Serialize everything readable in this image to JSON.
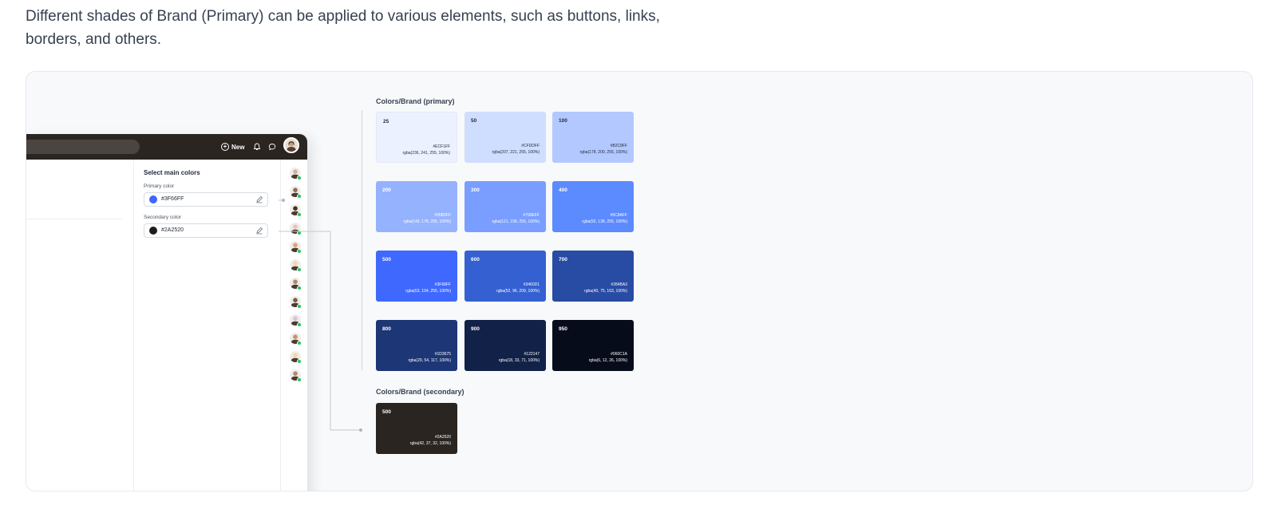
{
  "intro": {
    "text": "Different shades of Brand (Primary) can be applied to various elements, such as buttons, links, borders, and others."
  },
  "app": {
    "topbar": {
      "new_label": "New",
      "icons": [
        "plus-circle-icon",
        "bell-icon",
        "chat-icon"
      ]
    },
    "settings": {
      "title": "Select main colors",
      "primary_label": "Primary color",
      "primary_value": "#3F66FF",
      "primary_swatch": "#3F66FF",
      "secondary_label": "Secondary color",
      "secondary_value": "#2A2520",
      "secondary_swatch": "#1f1b17"
    },
    "avatars": [
      "#c9b49f",
      "#8a6f5c",
      "#3d3128",
      "#e3c2c8",
      "#d9a27a",
      "#f0d3b8",
      "#b0876a",
      "#7c5a48",
      "#d6c1e0",
      "#c49070",
      "#f1d7b0",
      "#a88c74"
    ]
  },
  "palette": {
    "primary": {
      "title": "Colors/Brand (primary)",
      "shades": [
        {
          "shade": "25",
          "hex": "#ECF1FF",
          "rgba": "rgba(236, 241, 255, 100%)",
          "bg": "#ECF1FF",
          "text": "#1f2937"
        },
        {
          "shade": "50",
          "hex": "#CFDDFF",
          "rgba": "rgba(207, 221, 255, 100%)",
          "bg": "#CFDDFF",
          "text": "#1f2937"
        },
        {
          "shade": "100",
          "hex": "#B2C8FF",
          "rgba": "rgba(178, 200, 255, 100%)",
          "bg": "#B2C8FF",
          "text": "#1f2937"
        },
        {
          "shade": "200",
          "hex": "#95B2FF",
          "rgba": "rgba(149, 178, 255, 100%)",
          "bg": "#95B2FF",
          "text": "#ffffff"
        },
        {
          "shade": "300",
          "hex": "#799EFF",
          "rgba": "rgba(121, 158, 255, 100%)",
          "bg": "#799EFF",
          "text": "#ffffff"
        },
        {
          "shade": "400",
          "hex": "#5C8AFF",
          "rgba": "rgba(92, 138, 255, 100%)",
          "bg": "#5C8AFF",
          "text": "#ffffff"
        },
        {
          "shade": "500",
          "hex": "#3F68FF",
          "rgba": "rgba(63, 104, 255, 100%)",
          "bg": "#3F68FF",
          "text": "#ffffff"
        },
        {
          "shade": "600",
          "hex": "#3460D1",
          "rgba": "rgba(52, 96, 209, 100%)",
          "bg": "#3460D1",
          "text": "#ffffff"
        },
        {
          "shade": "700",
          "hex": "#284BA3",
          "rgba": "rgba(40, 75, 163, 100%)",
          "bg": "#284BA3",
          "text": "#ffffff"
        },
        {
          "shade": "800",
          "hex": "#1D3675",
          "rgba": "rgba(29, 54, 117, 100%)",
          "bg": "#1D3675",
          "text": "#ffffff"
        },
        {
          "shade": "900",
          "hex": "#122147",
          "rgba": "rgba(18, 33, 71, 100%)",
          "bg": "#122147",
          "text": "#ffffff"
        },
        {
          "shade": "950",
          "hex": "#060C1A",
          "rgba": "rgba(6, 12, 26, 100%)",
          "bg": "#060C1A",
          "text": "#ffffff"
        }
      ]
    },
    "secondary": {
      "title": "Colors/Brand (secondary)",
      "shade": "500",
      "hex": "#2A2520",
      "rgba": "rgba(42, 37, 32, 100%)",
      "bg": "#2A2520",
      "text": "#ffffff"
    }
  }
}
